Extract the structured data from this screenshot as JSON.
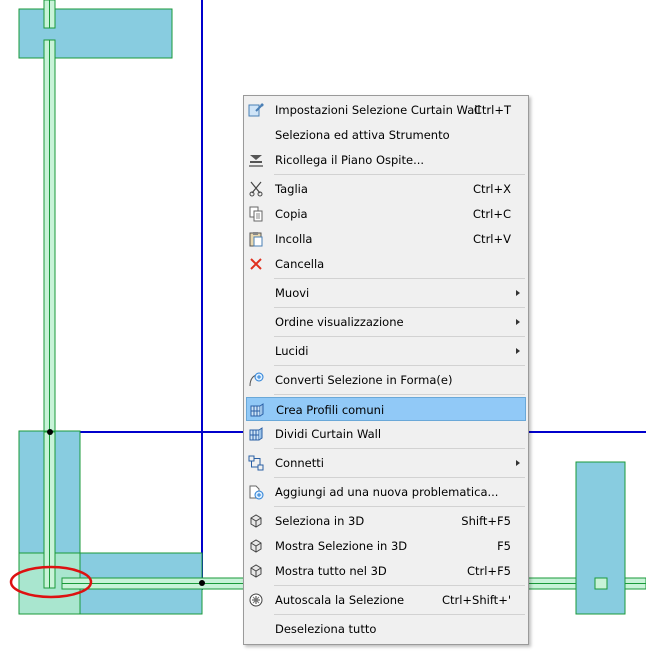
{
  "menu": {
    "items": [
      {
        "label": "Impostazioni Selezione Curtain Wall",
        "shortcut": "Ctrl+T",
        "icon": "settings-icon"
      },
      {
        "label": "Seleziona ed attiva Strumento",
        "shortcut": "",
        "icon": ""
      },
      {
        "label": "Ricollega il Piano Ospite...",
        "shortcut": "",
        "icon": "relink-story-icon"
      },
      {
        "label": "Taglia",
        "shortcut": "Ctrl+X",
        "icon": "scissors-icon"
      },
      {
        "label": "Copia",
        "shortcut": "Ctrl+C",
        "icon": "copy-icon"
      },
      {
        "label": "Incolla",
        "shortcut": "Ctrl+V",
        "icon": "paste-icon"
      },
      {
        "label": "Cancella",
        "shortcut": "",
        "icon": "delete-icon"
      },
      {
        "label": "Muovi",
        "shortcut": "",
        "icon": ""
      },
      {
        "label": "Ordine visualizzazione",
        "shortcut": "",
        "icon": ""
      },
      {
        "label": "Lucidi",
        "shortcut": "",
        "icon": ""
      },
      {
        "label": "Converti Selezione in Forma(e)",
        "shortcut": "",
        "icon": "convert-shape-icon"
      },
      {
        "label": "Crea Profili comuni",
        "shortcut": "",
        "icon": "common-profiles-icon"
      },
      {
        "label": "Dividi Curtain Wall",
        "shortcut": "",
        "icon": "split-curtain-wall-icon"
      },
      {
        "label": "Connetti",
        "shortcut": "",
        "icon": "connect-icon"
      },
      {
        "label": "Aggiungi ad una nuova problematica...",
        "shortcut": "",
        "icon": "add-issue-icon"
      },
      {
        "label": "Seleziona in 3D",
        "shortcut": "Shift+F5",
        "icon": "select-3d-icon"
      },
      {
        "label": "Mostra Selezione in 3D",
        "shortcut": "F5",
        "icon": "show-selection-3d-icon"
      },
      {
        "label": "Mostra tutto nel 3D",
        "shortcut": "Ctrl+F5",
        "icon": "show-all-3d-icon"
      },
      {
        "label": "Autoscala la Selezione",
        "shortcut": "Ctrl+Shift+'",
        "icon": "zoom-selection-icon"
      },
      {
        "label": "Deseleziona tutto",
        "shortcut": "",
        "icon": ""
      }
    ]
  },
  "colors": {
    "menu_bg": "#f0f0f0",
    "highlight": "#91c9f7",
    "element_fill": "#88cce0",
    "element_stroke": "#1a9a3a",
    "gridline": "#0000cc",
    "marker": "#dd1111"
  }
}
